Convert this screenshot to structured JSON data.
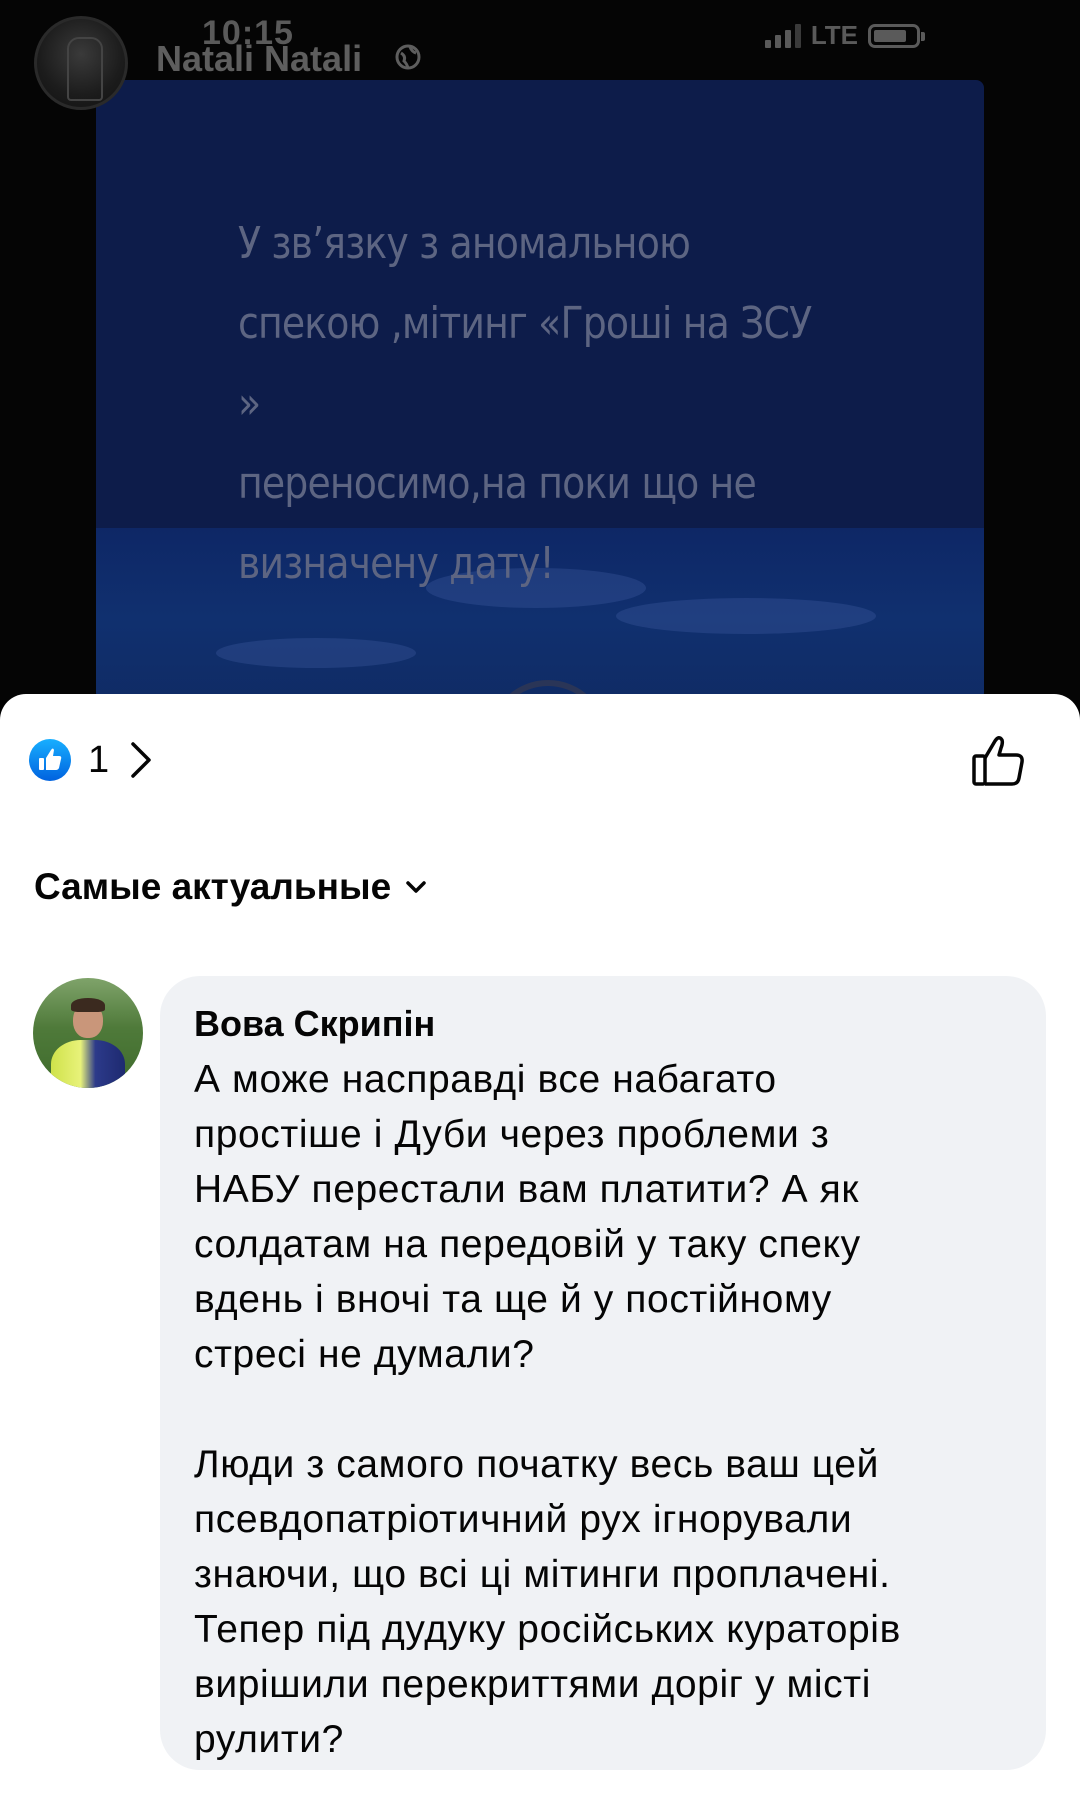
{
  "status_bar": {
    "time": "10:15",
    "network": "LTE"
  },
  "post": {
    "author_name": "Natali Natali",
    "text": "У звʼязку з аномальною\nспекою ,мітинг «Гроші на ЗСУ »\nпереносимо,на поки що не\nвизначену дату!"
  },
  "reactions": {
    "count": "1"
  },
  "sort": {
    "label": "Самые актуальные"
  },
  "comment": {
    "author": "Вова Скрипін",
    "text": "А може насправді все набагато\nпростіше і Дуби через проблеми з\nНАБУ перестали вам платити? А як\nсолдатам на передовій у таку спеку\nвдень і вночі та ще й у постійному\nстресі не думали?\n\nЛюди з самого початку весь ваш цей\nпсевдопатріотичний рух ігнорували\nзнаючи, що всі ці мітинги проплачені.\nТепер під дудуку російських кураторів\nвирішили перекриттями доріг у місті\nрулити?"
  },
  "colors": {
    "facebook_blue": "#1877f2",
    "bubble_bg": "#f0f2f5",
    "text_primary": "#050505"
  }
}
